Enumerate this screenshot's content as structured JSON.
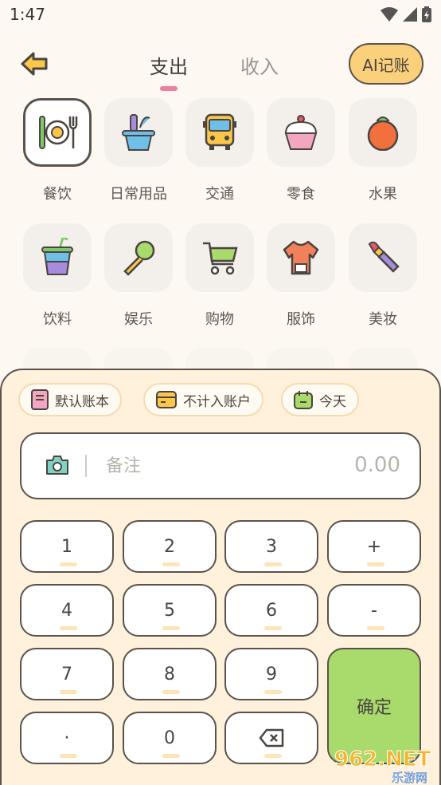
{
  "status_bar": {
    "time": "1:47"
  },
  "header": {
    "tabs": [
      {
        "label": "支出"
      },
      {
        "label": "收入"
      }
    ],
    "ai_button": "AI记账"
  },
  "categories": [
    {
      "label": "餐饮",
      "icon": "meal-icon"
    },
    {
      "label": "日常用品",
      "icon": "daily-goods-icon"
    },
    {
      "label": "交通",
      "icon": "bus-icon"
    },
    {
      "label": "零食",
      "icon": "cupcake-icon"
    },
    {
      "label": "水果",
      "icon": "fruit-icon"
    },
    {
      "label": "饮料",
      "icon": "drink-icon"
    },
    {
      "label": "娱乐",
      "icon": "microphone-icon"
    },
    {
      "label": "购物",
      "icon": "cart-icon"
    },
    {
      "label": "服饰",
      "icon": "shirt-icon"
    },
    {
      "label": "美妆",
      "icon": "lipstick-icon"
    }
  ],
  "chips": [
    {
      "label": "默认账本",
      "icon": "book-icon"
    },
    {
      "label": "不计入账户",
      "icon": "wallet-icon"
    },
    {
      "label": "今天",
      "icon": "calendar-icon"
    }
  ],
  "note": {
    "placeholder": "备注",
    "amount": "0.00"
  },
  "keypad": {
    "keys": [
      "1",
      "2",
      "3",
      "+",
      "4",
      "5",
      "6",
      "-",
      "7",
      "8",
      "9",
      "·",
      "0"
    ],
    "confirm": "确定"
  },
  "watermark": {
    "text": "962.NET",
    "sub": "乐游网"
  },
  "colors": {
    "accent_pink": "#ef7fa0",
    "ai_button": "#fbd07a",
    "confirm_green": "#a8da6c",
    "sheet_bg": "#fff1dc"
  }
}
